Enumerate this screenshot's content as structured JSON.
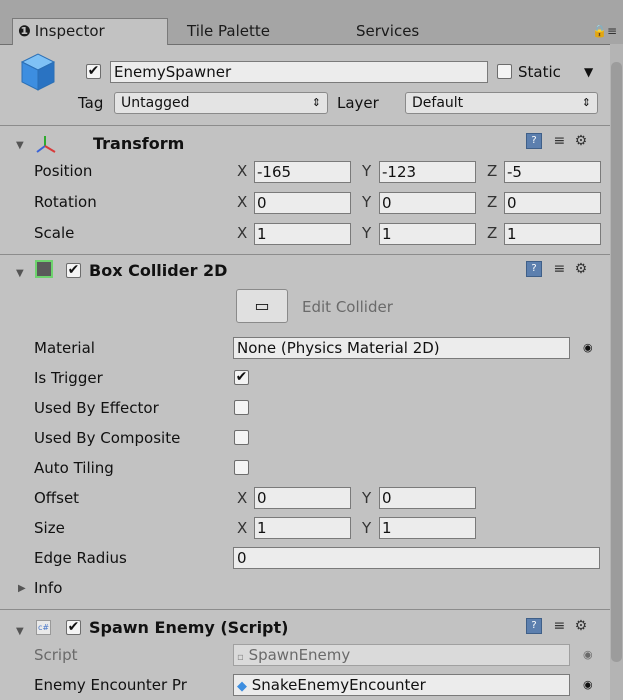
{
  "tabs": [
    {
      "label": "Inspector",
      "active": true,
      "icon": "info-icon"
    },
    {
      "label": "Tile Palette",
      "active": false
    },
    {
      "label": "Services",
      "active": false
    }
  ],
  "gameobject": {
    "name": "EnemySpawner",
    "active": true,
    "static_label": "Static",
    "tag_label": "Tag",
    "tag_value": "Untagged",
    "layer_label": "Layer",
    "layer_value": "Default"
  },
  "transform": {
    "title": "Transform",
    "rows": [
      {
        "label": "Position",
        "x": "-165",
        "y": "-123",
        "z": "-5"
      },
      {
        "label": "Rotation",
        "x": "0",
        "y": "0",
        "z": "0"
      },
      {
        "label": "Scale",
        "x": "1",
        "y": "1",
        "z": "1"
      }
    ]
  },
  "box_collider": {
    "title": "Box Collider 2D",
    "edit_collider_label": "Edit Collider",
    "material_label": "Material",
    "material_value": "None (Physics Material 2D)",
    "is_trigger_label": "Is Trigger",
    "is_trigger": true,
    "used_by_effector_label": "Used By Effector",
    "used_by_effector": false,
    "used_by_composite_label": "Used By Composite",
    "used_by_composite": false,
    "auto_tiling_label": "Auto Tiling",
    "auto_tiling": false,
    "offset_label": "Offset",
    "offset_x": "0",
    "offset_y": "0",
    "size_label": "Size",
    "size_x": "1",
    "size_y": "1",
    "edge_radius_label": "Edge Radius",
    "edge_radius": "0",
    "info_label": "Info"
  },
  "spawn_enemy": {
    "title": "Spawn Enemy (Script)",
    "script_label": "Script",
    "script_value": "SpawnEnemy",
    "encounter_label": "Enemy Encounter Pr",
    "encounter_value": "SnakeEnemyEncounter"
  },
  "axis": {
    "x": "X",
    "y": "Y",
    "z": "Z"
  },
  "colors": {
    "panel_bg": "#c2c2c2",
    "tabbar_bg": "#a5a5a5",
    "field_bg": "#ececec",
    "help_icon": "#5c7fae",
    "cube_blue": "#3d8ee0"
  }
}
